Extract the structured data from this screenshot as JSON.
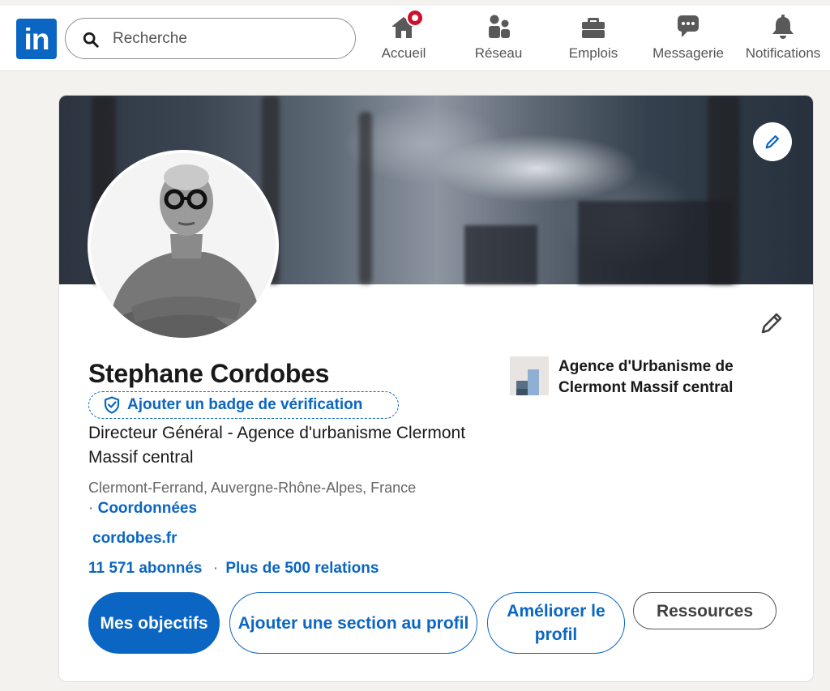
{
  "nav": {
    "logo_text": "in",
    "search_placeholder": "Recherche",
    "items": [
      {
        "label": "Accueil",
        "icon": "home-icon"
      },
      {
        "label": "Réseau",
        "icon": "network-icon"
      },
      {
        "label": "Emplois",
        "icon": "briefcase-icon"
      },
      {
        "label": "Messagerie",
        "icon": "chat-icon"
      },
      {
        "label": "Notifications",
        "icon": "bell-icon"
      }
    ]
  },
  "profile": {
    "name": "Stephane Cordobes",
    "verify_label": "Ajouter un badge de vérification",
    "headline": "Directeur Général - Agence d'urbanisme Clermont Massif central",
    "location": "Clermont-Ferrand, Auvergne-Rhône-Alpes, France",
    "location_sep": "·",
    "contact_label": "Coordonnées",
    "website": "cordobes.fr",
    "followers": "11 571 abonnés",
    "stats_sep": "·",
    "connections": "Plus de 500 relations",
    "company": "Agence d'Urbanisme de Clermont Massif central"
  },
  "actions": {
    "goals": "Mes objectifs",
    "add_section": "Ajouter une section au profil",
    "improve": "Améliorer le profil",
    "resources": "Ressources"
  },
  "colors": {
    "brand": "#0a66c2",
    "notification": "#cb112d"
  }
}
